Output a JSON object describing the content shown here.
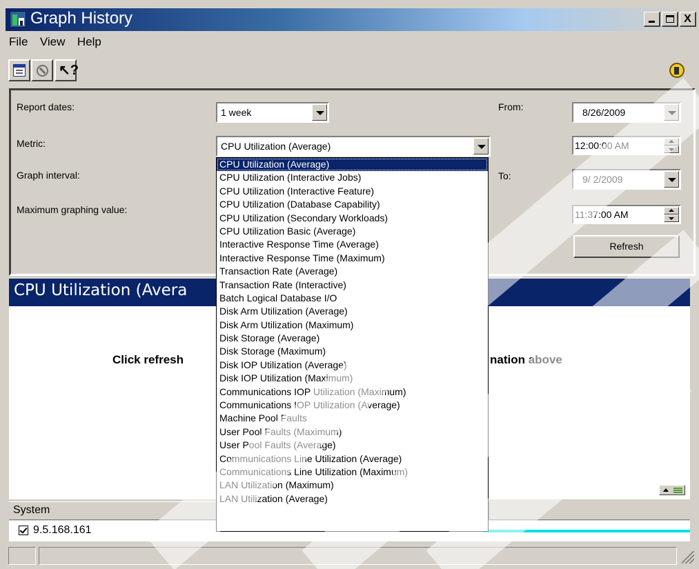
{
  "window": {
    "title": "Graph History",
    "minimize_label": "_",
    "close_label": "X"
  },
  "menu": [
    "File",
    "View",
    "Help"
  ],
  "toolbar": {
    "help_glyph": "?",
    "icons": [
      "properties-icon",
      "stop-icon",
      "whats-this-help-icon",
      "status-indicator-icon"
    ]
  },
  "settings": {
    "report_dates": {
      "label": "Report dates:",
      "value": "1 week"
    },
    "metric": {
      "label": "Metric:",
      "value": "CPU Utilization (Average)"
    },
    "graph_interval": {
      "label": "Graph interval:"
    },
    "max_value": {
      "label": "Maximum graphing value:"
    },
    "from": {
      "label": "From:",
      "date": "8/26/2009",
      "time": "12:00:00 AM"
    },
    "to": {
      "label": "To:",
      "date": "9/ 2/2009",
      "time": "11:37:00 AM"
    },
    "refresh_label": "Refresh"
  },
  "metric_options": [
    "CPU Utilization (Average)",
    "CPU Utilization (Interactive Jobs)",
    "CPU Utilization (Interactive Feature)",
    "CPU Utilization (Database Capability)",
    "CPU Utilization (Secondary Workloads)",
    "CPU Utilization Basic (Average)",
    "Interactive Response Time (Average)",
    "Interactive Response Time (Maximum)",
    "Transaction Rate (Average)",
    "Transaction Rate (Interactive)",
    "Batch Logical Database I/O",
    "Disk Arm Utilization (Average)",
    "Disk Arm Utilization (Maximum)",
    "Disk Storage (Average)",
    "Disk Storage (Maximum)",
    "Disk IOP Utilization (Average)",
    "Disk IOP Utilization (Maximum)",
    "Communications IOP Utilization (Maximum)",
    "Communications IOP Utilization (Average)",
    "Machine Pool Faults",
    "User Pool Faults (Maximum)",
    "User Pool Faults (Average)",
    "Communications Line Utilization (Average)",
    "Communications Line Utilization (Maximum)",
    "LAN Utilization (Maximum)",
    "LAN Utilization (Average)"
  ],
  "selected_metric_index": 0,
  "graph": {
    "title_visible": "CPU Utilization (Avera",
    "message_left": "Click refresh",
    "message_right": "nation above"
  },
  "system_list": {
    "header": "System",
    "rows": [
      {
        "name": "9.5.168.161",
        "checked": true
      }
    ]
  },
  "colors": {
    "title_bar": "#0a246a",
    "selection": "#0a246a",
    "system_line": "#00e0e8",
    "face": "#d4d0c8"
  }
}
